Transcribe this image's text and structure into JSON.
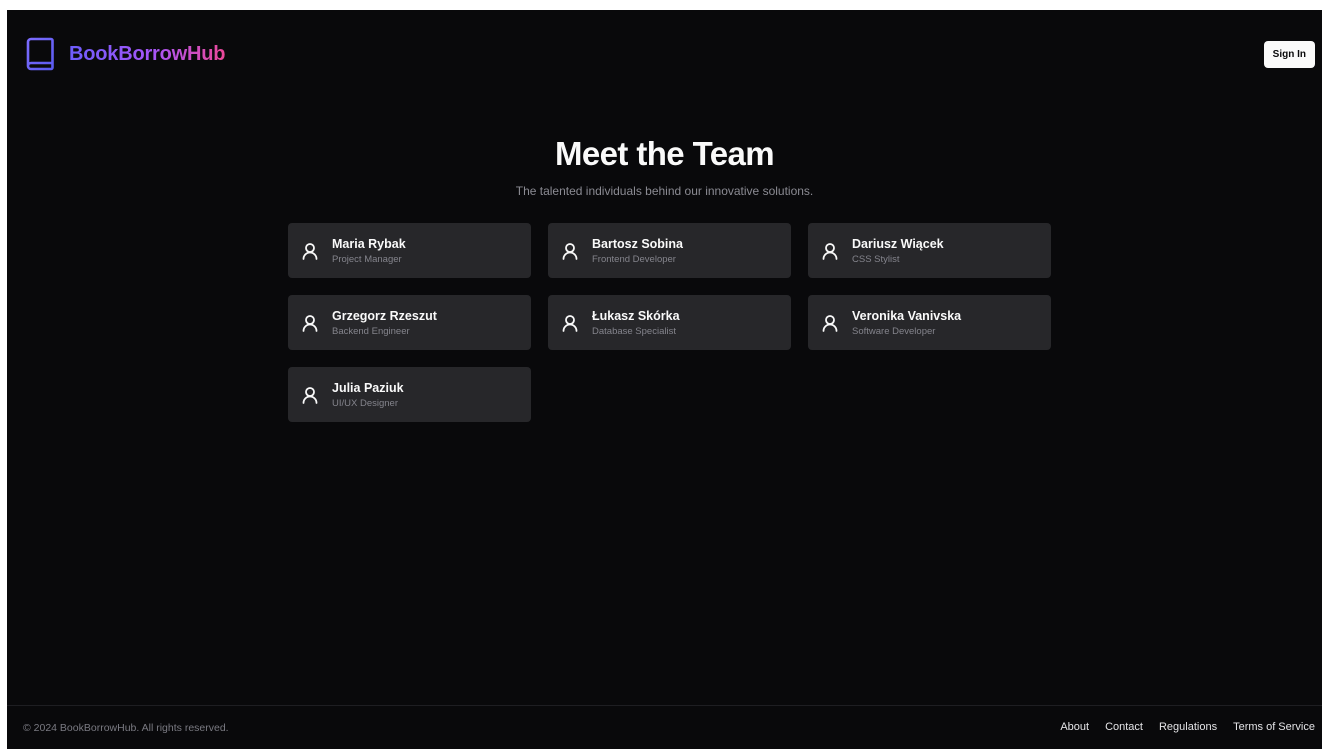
{
  "brand": {
    "name": "BookBorrowHub",
    "icon": "book-icon",
    "gradient": [
      "#6d5dfc",
      "#a855f7",
      "#ec4899"
    ]
  },
  "header": {
    "signin_label": "Sign In"
  },
  "main": {
    "title": "Meet the Team",
    "subtitle": "The talented individuals behind our innovative solutions.",
    "members": [
      {
        "name": "Maria Rybak",
        "role": "Project Manager",
        "icon": "user-icon"
      },
      {
        "name": "Bartosz Sobina",
        "role": "Frontend Developer",
        "icon": "user-icon"
      },
      {
        "name": "Dariusz Wiącek",
        "role": "CSS Stylist",
        "icon": "user-icon"
      },
      {
        "name": "Grzegorz Rzeszut",
        "role": "Backend Engineer",
        "icon": "user-icon"
      },
      {
        "name": "Łukasz Skórka",
        "role": "Database Specialist",
        "icon": "user-icon"
      },
      {
        "name": "Veronika Vanivska",
        "role": "Software Developer",
        "icon": "user-icon"
      },
      {
        "name": "Julia Paziuk",
        "role": "UI/UX Designer",
        "icon": "user-icon"
      }
    ]
  },
  "footer": {
    "copyright": "© 2024 BookBorrowHub. All rights reserved.",
    "links": [
      "About",
      "Contact",
      "Regulations",
      "Terms of Service"
    ]
  },
  "colors": {
    "background": "#09090b",
    "card": "#27272a",
    "text": "#fafafa",
    "muted": "#84848c"
  }
}
